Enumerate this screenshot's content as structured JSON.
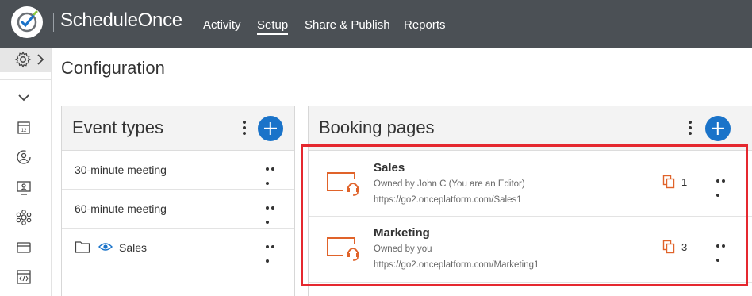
{
  "app": {
    "brand": "ScheduleOnce"
  },
  "nav": {
    "items": [
      "Activity",
      "Setup",
      "Share & Publish",
      "Reports"
    ],
    "active": "Setup"
  },
  "page": {
    "title": "Configuration"
  },
  "event_types": {
    "title": "Event types",
    "items": [
      {
        "label": "30-minute meeting"
      },
      {
        "label": "60-minute meeting"
      },
      {
        "label": "Sales",
        "icons": [
          "folder-icon",
          "eye-icon"
        ]
      }
    ]
  },
  "booking_pages": {
    "title": "Booking pages",
    "items": [
      {
        "name": "Sales",
        "owner": "Owned by John C (You are an Editor)",
        "url": "https://go2.onceplatform.com/Sales1",
        "count": "1"
      },
      {
        "name": "Marketing",
        "owner": "Owned by you",
        "url": "https://go2.onceplatform.com/Marketing1",
        "count": "3"
      }
    ]
  },
  "colors": {
    "topbar": "#4b5055",
    "accent": "#1a73c9",
    "booking_icon": "#e0632a",
    "highlight": "#e5282f"
  }
}
